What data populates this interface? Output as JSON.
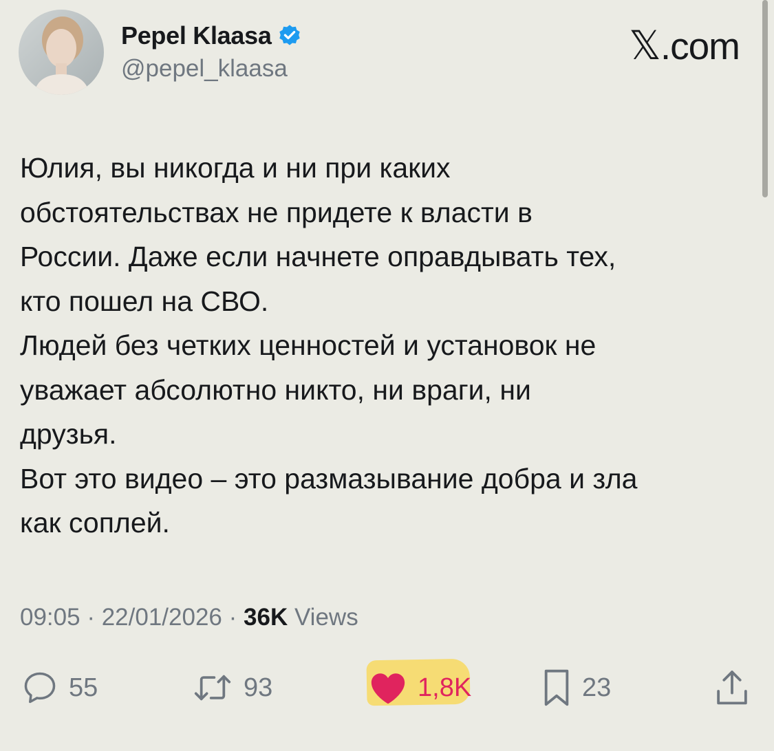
{
  "tweet": {
    "author": {
      "display_name": "Pepel Klaasa",
      "handle": "@pepel_klaasa",
      "verified": true
    },
    "text": "Юлия, вы никогда и ни при каких\nобстоятельствах не придете к власти в\nРоссии. Даже если начнете оправдывать тех,\nкто пошел на СВО.\nЛюдей без четких ценностей и установок не\nуважает абсолютно никто, ни враги, ни\nдрузья.\nВот это видео – это размазывание добра и зла\nкак соплей.",
    "time": "09:05",
    "date": "22/01/2026",
    "views_count": "36K",
    "views_label": "Views",
    "separator": "·",
    "stats": {
      "replies": "55",
      "reposts": "93",
      "likes": "1,8K",
      "bookmarks": "23"
    }
  },
  "brand": {
    "mark": "𝕏",
    "suffix": ".com"
  },
  "icons": {
    "verified": "verified-badge-icon",
    "reply": "speech-bubble-icon",
    "repost": "repost-arrows-icon",
    "like": "heart-icon",
    "bookmark": "bookmark-icon",
    "share": "share-upload-icon"
  },
  "colors": {
    "background": "#ebebe4",
    "text": "#17191c",
    "secondary_text": "#6f7780",
    "verified_blue": "#1d9bf0",
    "like_red": "#e0245e",
    "highlighter_yellow": "#f6dc74"
  }
}
